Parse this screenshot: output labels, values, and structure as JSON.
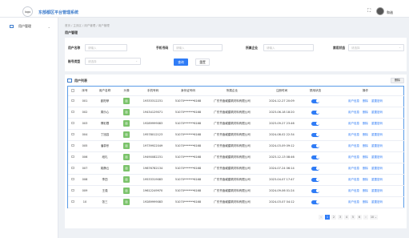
{
  "header": {
    "logo_text": "logo",
    "app_title": "东部都区平台管理系统",
    "fullscreen_glyph": "⛶",
    "username": "和谐"
  },
  "sidebar": {
    "items": [
      {
        "label": "用户管理",
        "arrow": "⌄",
        "icon": "user-manage-icon"
      }
    ]
  },
  "breadcrumb": "首页 / 主页区 / 用户管理 / 用户管理",
  "page_title": "用户管理",
  "search": {
    "username_label": "用户名称",
    "username_placeholder": "请输入",
    "phone_label": "手机号码",
    "phone_placeholder": "请输入",
    "company_label": "所属企业",
    "company_placeholder": "请输入",
    "status_label": "禁用状态",
    "status_placeholder": "请选择",
    "account_type_label": "账号类型",
    "account_type_placeholder": "请选择",
    "search_button": "查询",
    "reset_button": "重置"
  },
  "list": {
    "title": "用户列表",
    "delete_button": "删除",
    "columns": [
      "",
      "序号",
      "用户名称",
      "头像",
      "手机号码",
      "身份证号码",
      "所属企业",
      "注册时间",
      "禁用状态",
      "操作"
    ],
    "rows": [
      {
        "no": "001",
        "name": "欧阳菲",
        "avatar": "图",
        "phone": "19333312231",
        "id": "51070*******6168",
        "company": "广东齐鑫威建筑材料有限公司",
        "time": "2024-12-27 20:09",
        "enabled": true
      },
      {
        "no": "002",
        "name": "周乐心",
        "avatar": "图",
        "phone": "19434129071",
        "id": "51070*******6168",
        "company": "广东齐鑫威建筑材料有限公司",
        "time": "2023-06-18 18:20",
        "enabled": true
      },
      {
        "no": "003",
        "name": "傅彩蓉",
        "avatar": "图",
        "phone": "19289999083",
        "id": "51070*******6168",
        "company": "广东齐鑫威建筑材料有限公司",
        "time": "2023-09-27 23:46",
        "enabled": true
      },
      {
        "no": "004",
        "name": "丁旭容",
        "avatar": "图",
        "phone": "19578012123",
        "id": "51070*******6168",
        "company": "广东齐鑫威建筑材料有限公司",
        "time": "2024-08-02 22:34",
        "enabled": true
      },
      {
        "no": "005",
        "name": "潘慕彤",
        "avatar": "图",
        "phone": "19739922049",
        "id": "51070*******6168",
        "company": "广东齐鑫威建筑材料有限公司",
        "time": "2024-03-09 09:12",
        "enabled": true
      },
      {
        "no": "006",
        "name": "段礼",
        "avatar": "图",
        "phone": "19490082231",
        "id": "51070*******6168",
        "company": "广东齐鑫威建筑材料有限公司",
        "time": "2023-12-13 08:46",
        "enabled": true
      },
      {
        "no": "007",
        "name": "姚静云",
        "avatar": "图",
        "phone": "19876782134",
        "id": "51070*******6168",
        "company": "广东齐鑫威建筑材料有限公司",
        "time": "2024-07-24 06:14",
        "enabled": true
      },
      {
        "no": "008",
        "name": "李四",
        "avatar": "图",
        "phone": "19533319083",
        "id": "51070*******6168",
        "company": "广东齐鑫威建筑材料有限公司",
        "time": "2023-04-07 17:47",
        "enabled": true
      },
      {
        "no": "009",
        "name": "王强",
        "avatar": "图",
        "phone": "19612249970",
        "id": "51070*******6168",
        "company": "广东齐鑫威建筑材料有限公司",
        "time": "2024-09-06 01:24",
        "enabled": true
      },
      {
        "no": "10",
        "name": "张三",
        "avatar": "图",
        "phone": "19289999083",
        "id": "51070*******6168",
        "company": "广东齐鑫威建筑材料有限公司",
        "time": "2024-03-07 04:12",
        "enabled": true
      }
    ],
    "actions": [
      "用户信息",
      "删除",
      "重置密码"
    ]
  },
  "pagination": {
    "prev": "‹",
    "pages": [
      "1",
      "2",
      "3",
      "4",
      "5",
      "6"
    ],
    "current": "1",
    "next": "›",
    "page_size": "10 ⌄"
  },
  "colors": {
    "primary": "#2f7cf6",
    "brand_title": "#3d7ccc",
    "avatar_green": "#7bc36b"
  }
}
